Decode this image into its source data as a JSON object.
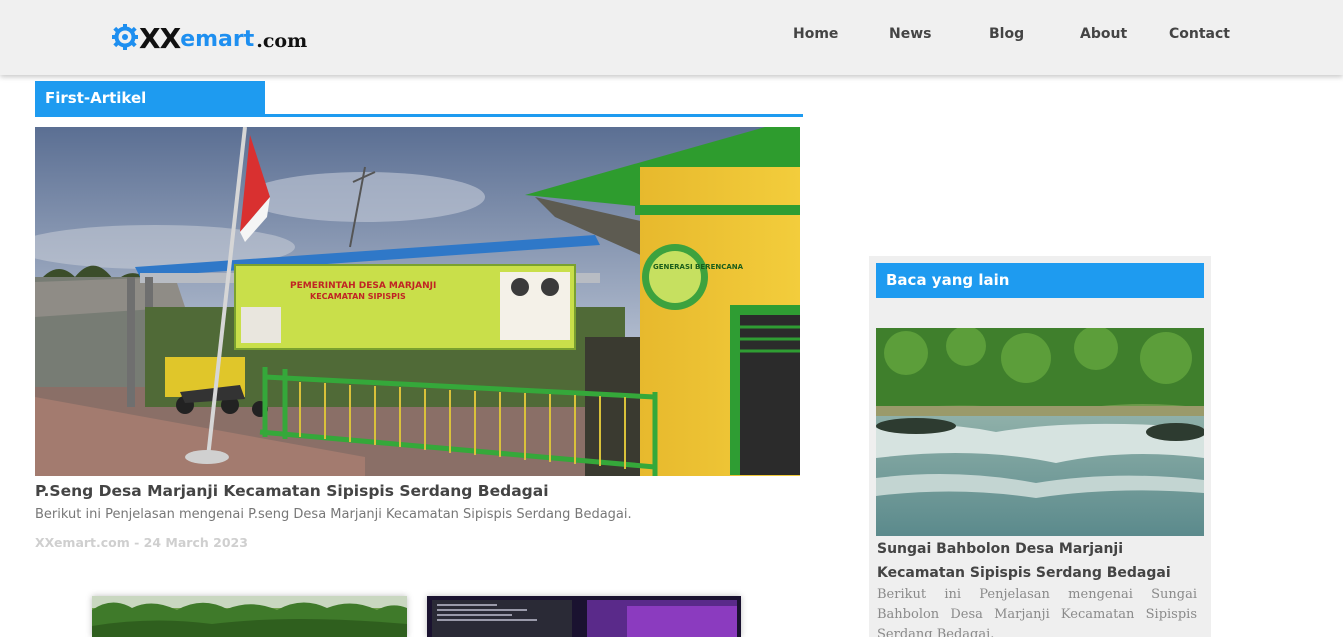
{
  "header": {
    "logo": {
      "xx": "XX",
      "emart": "emart",
      "com": ".com",
      "icon": "gear-icon",
      "color": "#1e8ff0"
    },
    "nav": [
      {
        "label": "Home"
      },
      {
        "label": "News"
      },
      {
        "label": "Blog"
      },
      {
        "label": "About"
      },
      {
        "label": "Contact"
      }
    ]
  },
  "main": {
    "section_title": "First-Artikel",
    "accent_color": "#1e9bf0",
    "featured": {
      "image": "village-office-photo",
      "title": "P.Seng Desa Marjanji Kecamatan Sipispis Serdang Bedagai",
      "excerpt": "Berikut ini Penjelasan mengenai P.seng Desa Marjanji Kecamatan Sipispis Serdang Bedagai.",
      "meta": "XXemart.com - 24 March 2023",
      "banner_text": "PEMERINTAH DESA MARJANJI",
      "banner_sub": "KECAMATAN SIPISPIS",
      "sign_text": "GENERASI BERENCANA"
    },
    "thumbnails": [
      {
        "image": "palm-trees-photo"
      },
      {
        "image": "terminal-screen-photo"
      }
    ]
  },
  "sidebar": {
    "title": "Baca yang lain",
    "post": {
      "image": "river-rapids-photo",
      "title": "Sungai Bahbolon Desa Marjanji Kecamatan Sipispis Serdang Bedagai",
      "excerpt": "Berikut ini Penjelasan mengenai Sungai Bahbolon Desa Marjanji Kecamatan Sipispis Serdang Bedagai."
    }
  }
}
